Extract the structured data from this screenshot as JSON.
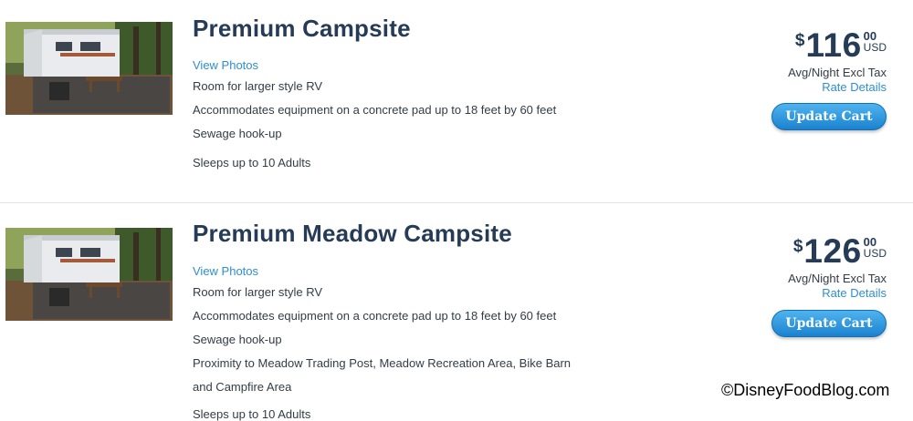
{
  "listings": [
    {
      "title": "Premium Campsite",
      "view_photos": "View Photos",
      "features": [
        "Room for larger style RV",
        "Accommodates equipment on a concrete pad up to 18 feet by 60 feet",
        "Sewage hook-up"
      ],
      "sleeps": "Sleeps up to 10 Adults",
      "price": {
        "currency_symbol": "$",
        "amount": "116",
        "cents": "00",
        "unit": "USD"
      },
      "rate_note": "Avg/Night Excl Tax",
      "rate_details": "Rate Details",
      "button_label": "Update Cart"
    },
    {
      "title": "Premium Meadow Campsite",
      "view_photos": "View Photos",
      "features": [
        "Room for larger style RV",
        "Accommodates equipment on a concrete pad up to 18 feet by 60 feet",
        "Sewage hook-up",
        "Proximity to Meadow Trading Post, Meadow Recreation Area, Bike Barn",
        "and Campfire Area"
      ],
      "sleeps": "Sleeps up to 10 Adults",
      "price": {
        "currency_symbol": "$",
        "amount": "126",
        "cents": "00",
        "unit": "USD"
      },
      "rate_note": "Avg/Night Excl Tax",
      "rate_details": "Rate Details",
      "button_label": "Update Cart"
    }
  ],
  "watermark": "©DisneyFoodBlog.com",
  "colors": {
    "title": "#253b56",
    "link": "#2e8fd1",
    "button_top": "#4fb3ee",
    "button_bottom": "#1b82cf"
  }
}
